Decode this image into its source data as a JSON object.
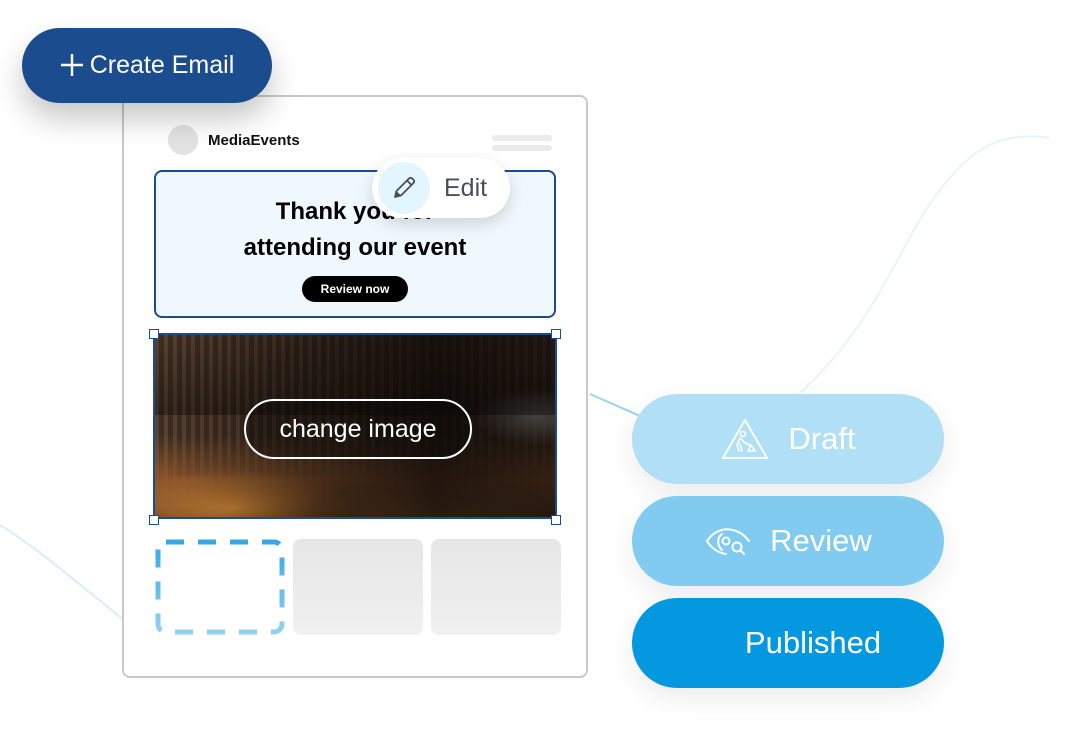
{
  "create_button": {
    "label": "Create Email",
    "icon": "plus-icon"
  },
  "email_preview": {
    "brand_name": "MediaEvents",
    "hero": {
      "title_line1": "Thank you for",
      "title_line2": "attending our event",
      "cta_label": "Review now"
    },
    "image_block": {
      "action_label": "change image"
    }
  },
  "edit_action": {
    "label": "Edit",
    "icon": "pencil-icon"
  },
  "statuses": [
    {
      "label": "Draft",
      "icon": "construction-sign-icon",
      "color": "#b1dff5"
    },
    {
      "label": "Review",
      "icon": "eye-search-icon",
      "color": "#82cbf0"
    },
    {
      "label": "Published",
      "icon": "",
      "color": "#0398df"
    }
  ],
  "colors": {
    "brand_blue": "#1b4c8e",
    "selection_border": "#1b4c8e",
    "dashed_placeholder": "#3aa9e3",
    "hero_background": "#f0f8fd"
  }
}
